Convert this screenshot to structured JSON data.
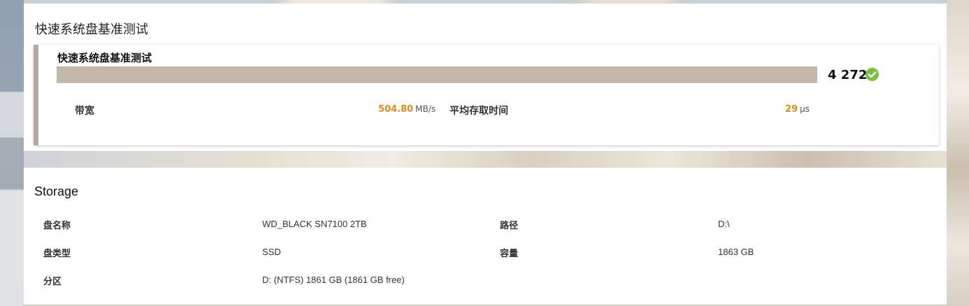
{
  "top_panel": {
    "title": "快速系统盘基准测试",
    "benchmark": {
      "name": "快速系统盘基准测试",
      "score": "4 272",
      "bar_fill_fraction": 1.0,
      "status_icon": "check-circle-icon",
      "status_color": "#7ac143",
      "bar_color": "#c4b8ab",
      "accent_color": "#e08a1e",
      "metrics": [
        {
          "label": "带宽",
          "value": "504.80",
          "unit": "MB/s"
        },
        {
          "label": "平均存取时间",
          "value": "29",
          "unit": "μs"
        }
      ]
    }
  },
  "storage": {
    "title": "Storage",
    "rows": [
      {
        "left_label": "盘名称",
        "left_value": "WD_BLACK SN7100 2TB",
        "right_label": "路径",
        "right_value": "D:\\"
      },
      {
        "left_label": "盘类型",
        "left_value": "SSD",
        "right_label": "容量",
        "right_value": "1863 GB"
      },
      {
        "left_label": "分区",
        "left_value": "D: (NTFS) 1861 GB (1861 GB free)"
      }
    ]
  }
}
